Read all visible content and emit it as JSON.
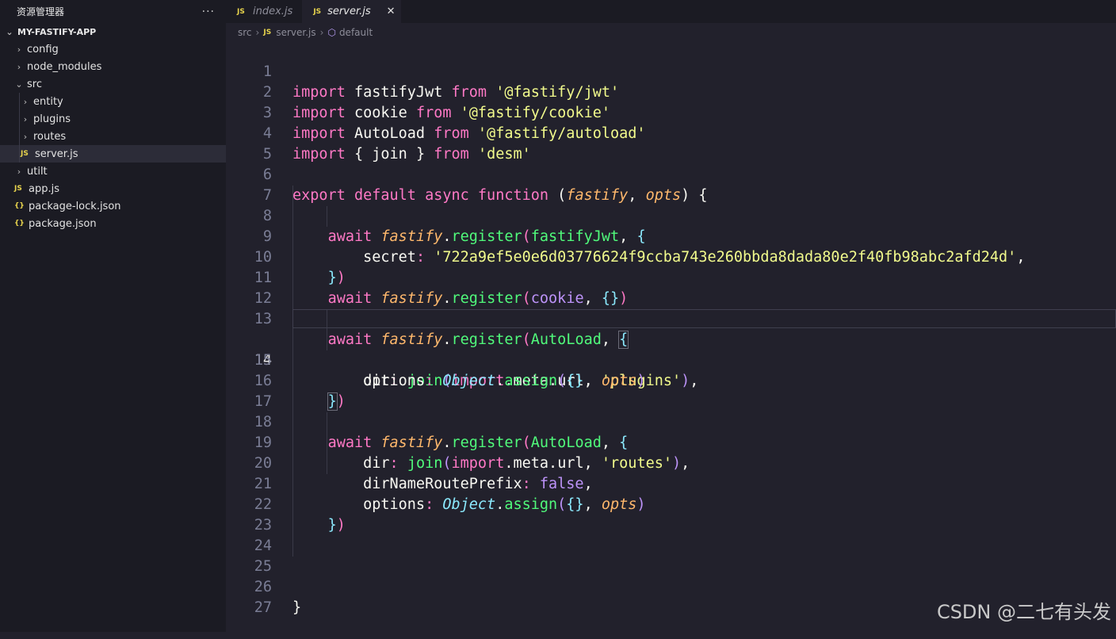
{
  "sidebar": {
    "title": "资源管理器",
    "more": "···",
    "project": "MY-FASTIFY-APP",
    "items": [
      {
        "label": "config",
        "type": "folder",
        "expanded": false,
        "depth": 1
      },
      {
        "label": "node_modules",
        "type": "folder",
        "expanded": false,
        "depth": 1
      },
      {
        "label": "src",
        "type": "folder",
        "expanded": true,
        "depth": 1
      },
      {
        "label": "entity",
        "type": "folder",
        "expanded": false,
        "depth": 2
      },
      {
        "label": "plugins",
        "type": "folder",
        "expanded": false,
        "depth": 2
      },
      {
        "label": "routes",
        "type": "folder",
        "expanded": false,
        "depth": 2
      },
      {
        "label": "server.js",
        "type": "js",
        "depth": 2,
        "active": true
      },
      {
        "label": "utilt",
        "type": "folder",
        "expanded": false,
        "depth": 1
      },
      {
        "label": "app.js",
        "type": "js",
        "depth": 1
      },
      {
        "label": "package-lock.json",
        "type": "json",
        "depth": 1
      },
      {
        "label": "package.json",
        "type": "json",
        "depth": 1
      }
    ]
  },
  "tabs": [
    {
      "label": "index.js",
      "badge": "JS",
      "active": false
    },
    {
      "label": "server.js",
      "badge": "JS",
      "active": true,
      "close": "✕"
    }
  ],
  "breadcrumb": {
    "folder": "src",
    "badge": "JS",
    "file": "server.js",
    "symbol": "default"
  },
  "editor": {
    "current_line": 14,
    "lines": [
      {
        "n": "1"
      },
      {
        "n": "2"
      },
      {
        "n": "3"
      },
      {
        "n": "4"
      },
      {
        "n": "5"
      },
      {
        "n": "6"
      },
      {
        "n": "7"
      },
      {
        "n": "8"
      },
      {
        "n": "9"
      },
      {
        "n": "10"
      },
      {
        "n": "11"
      },
      {
        "n": "12"
      },
      {
        "n": "13"
      },
      {
        "n": "14"
      },
      {
        "n": "15"
      },
      {
        "n": "16"
      },
      {
        "n": "17"
      },
      {
        "n": "18"
      },
      {
        "n": "19"
      },
      {
        "n": "20"
      },
      {
        "n": "21"
      },
      {
        "n": "22"
      },
      {
        "n": "23"
      },
      {
        "n": "24"
      },
      {
        "n": "25"
      },
      {
        "n": "26"
      },
      {
        "n": "27"
      }
    ],
    "tokens": {
      "import": "import",
      "from": "from",
      "export": "export",
      "default": "default",
      "async": "async",
      "function": "function",
      "await": "await",
      "fastifyJwt": "fastifyJwt",
      "cookie": "cookie",
      "AutoLoad": "AutoLoad",
      "join": "join",
      "str_jwt": "'@fastify/jwt'",
      "str_cookie": "'@fastify/cookie'",
      "str_autoload": "'@fastify/autoload'",
      "str_desm": "'desm'",
      "fastify": "fastify",
      "opts": "opts",
      "register": "register",
      "secret": "secret",
      "secret_val": "'722a9ef5e0e6d03776624f9ccba743e260bbda8dada80e2f40fb98abc2afd24d'",
      "dir": "dir",
      "meta": "meta",
      "url": "url",
      "str_plugins": "'plugins'",
      "str_routes": "'routes'",
      "options": "options",
      "Object": "Object",
      "assign": "assign",
      "dirNameRoutePrefix": "dirNameRoutePrefix",
      "false": "false"
    }
  },
  "watermark": "CSDN @二七有头发"
}
